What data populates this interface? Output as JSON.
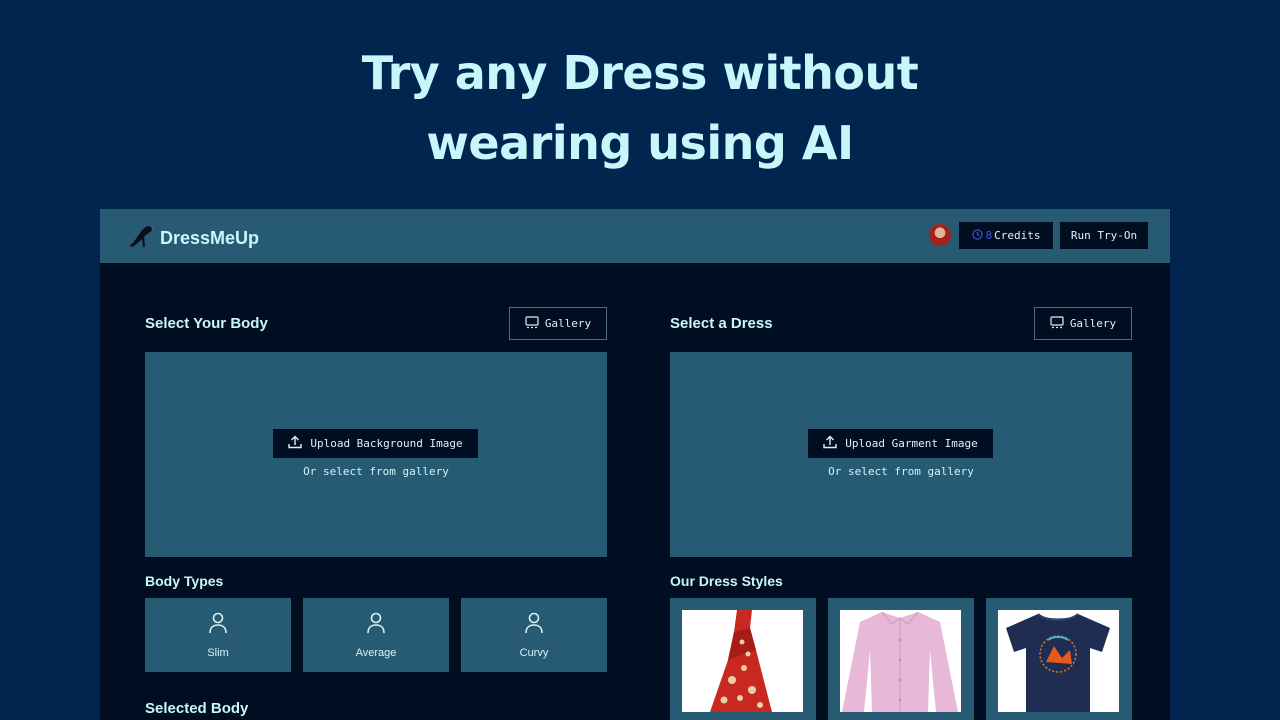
{
  "hero": {
    "line1": "Try any Dress without",
    "line2": "wearing using AI"
  },
  "navbar": {
    "brand": "DressMeUp",
    "brand_icon": "high-heel-icon",
    "credits_count": "8",
    "credits_label": "Credits",
    "run_label": "Run Try-On"
  },
  "body_panel": {
    "title": "Select Your Body",
    "gallery_label": "Gallery",
    "upload_label": "Upload Background Image",
    "hint": "Or select from gallery"
  },
  "dress_panel": {
    "title": "Select a Dress",
    "gallery_label": "Gallery",
    "upload_label": "Upload Garment Image",
    "hint": "Or select from gallery"
  },
  "body_types": {
    "title": "Body Types",
    "items": [
      {
        "label": "Slim",
        "icon": "user-icon"
      },
      {
        "label": "Average",
        "icon": "user-icon"
      },
      {
        "label": "Curvy",
        "icon": "user-icon"
      }
    ]
  },
  "dress_styles": {
    "title": "Our Dress Styles",
    "items": [
      {
        "name": "floral-dress"
      },
      {
        "name": "pink-shirt"
      },
      {
        "name": "navy-tshirt"
      }
    ]
  },
  "selected_body": {
    "title": "Selected Body"
  },
  "colors": {
    "page_bg": "#022550",
    "app_bg": "#010e22",
    "panel_bg": "#275a73",
    "heading": "#c8f7fb",
    "credits_accent": "#3b55d9"
  }
}
